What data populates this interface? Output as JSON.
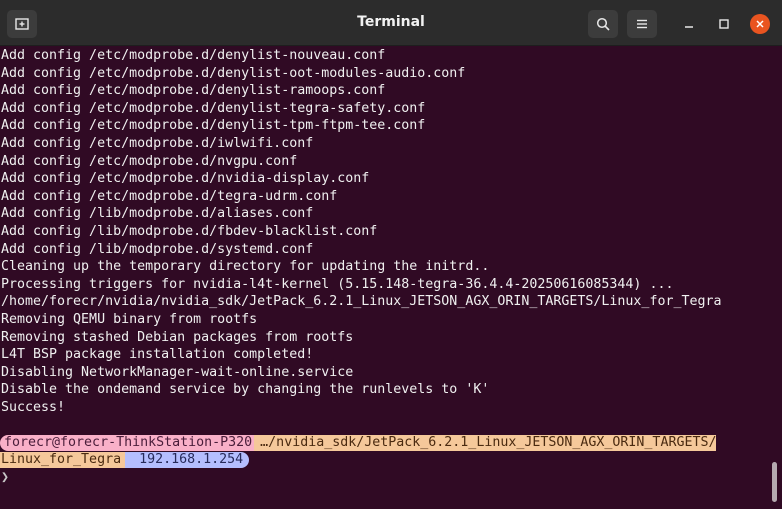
{
  "window": {
    "title": "Terminal"
  },
  "terminal": {
    "lines": [
      "Add config /etc/modprobe.d/denylist-nouveau.conf",
      "Add config /etc/modprobe.d/denylist-oot-modules-audio.conf",
      "Add config /etc/modprobe.d/denylist-ramoops.conf",
      "Add config /etc/modprobe.d/denylist-tegra-safety.conf",
      "Add config /etc/modprobe.d/denylist-tpm-ftpm-tee.conf",
      "Add config /etc/modprobe.d/iwlwifi.conf",
      "Add config /etc/modprobe.d/nvgpu.conf",
      "Add config /etc/modprobe.d/nvidia-display.conf",
      "Add config /etc/modprobe.d/tegra-udrm.conf",
      "Add config /lib/modprobe.d/aliases.conf",
      "Add config /lib/modprobe.d/fbdev-blacklist.conf",
      "Add config /lib/modprobe.d/systemd.conf",
      "Cleaning up the temporary directory for updating the initrd..",
      "Processing triggers for nvidia-l4t-kernel (5.15.148-tegra-36.4.4-20250616085344) ...",
      "/home/forecr/nvidia/nvidia_sdk/JetPack_6.2.1_Linux_JETSON_AGX_ORIN_TARGETS/Linux_for_Tegra",
      "Removing QEMU binary from rootfs",
      "Removing stashed Debian packages from rootfs",
      "L4T BSP package installation completed!",
      "Disabling NetworkManager-wait-online.service",
      "Disable the ondemand service by changing the runlevels to 'K'",
      "Success!",
      ""
    ],
    "prompt": {
      "user_host": "forecr@forecr-ThinkStation-P320",
      "path_line1": "…/nvidia_sdk/JetPack_6.2.1_Linux_JETSON_AGX_ORIN_TARGETS/",
      "path_line2": "Linux_for_Tegra",
      "ip": "192.168.1.254",
      "chevron": "❯"
    }
  },
  "colors": {
    "background": "#300a24",
    "titlebar": "#2c2c2c",
    "close_button": "#e95420",
    "segment_user": "#f9b0c8",
    "segment_path": "#f5c89a",
    "segment_ip": "#b4befe"
  },
  "icons": {
    "new_tab": "new-tab-icon",
    "search": "search-icon",
    "menu": "hamburger-menu-icon",
    "minimize": "minimize-icon",
    "maximize": "maximize-icon",
    "close": "close-icon"
  }
}
